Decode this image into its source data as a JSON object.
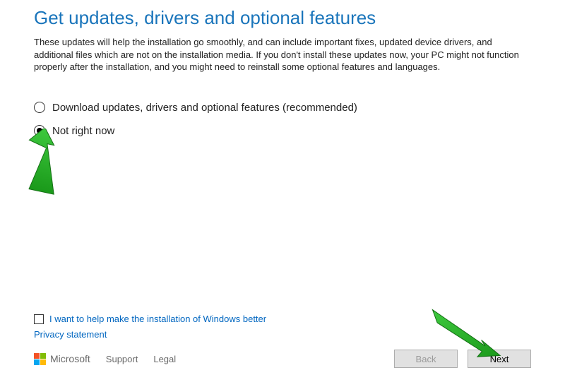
{
  "title": "Get updates, drivers and optional features",
  "description": "These updates will help the installation go smoothly, and can include important fixes, updated device drivers, and additional files which are not on the installation media. If you don't install these updates now, your PC might not function properly after the installation, and you might need to reinstall some optional features and languages.",
  "options": {
    "download": "Download updates, drivers and optional features (recommended)",
    "not_now": "Not right now"
  },
  "help_checkbox": "I want to help make the installation of Windows better",
  "privacy_link": "Privacy statement",
  "footer": {
    "brand": "Microsoft",
    "support": "Support",
    "legal": "Legal"
  },
  "buttons": {
    "back": "Back",
    "next": "Next"
  }
}
